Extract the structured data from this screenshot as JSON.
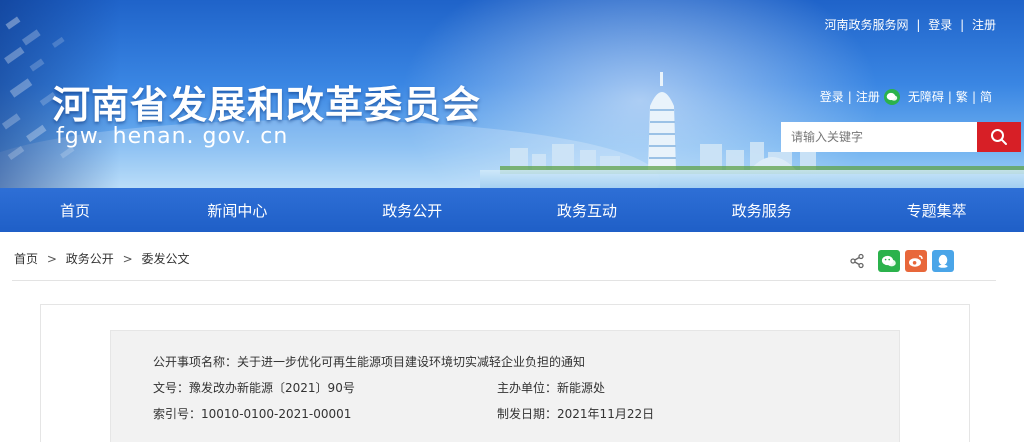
{
  "header": {
    "title": "河南省发展和改革委员会",
    "domain": "fgw. henan. gov. cn",
    "top_links": {
      "service_net": "河南政务服务网",
      "login": "登录",
      "register": "注册",
      "sep": "|"
    },
    "util_links": {
      "login": "登录",
      "register": "注册",
      "accessibility": "无障碍",
      "traditional": "繁",
      "simplified": "简",
      "sep": "|"
    },
    "search": {
      "placeholder": "请输入关键字",
      "button_color": "#d71f26"
    }
  },
  "nav": {
    "items": [
      {
        "label": "首页"
      },
      {
        "label": "新闻中心"
      },
      {
        "label": "政务公开"
      },
      {
        "label": "政务互动"
      },
      {
        "label": "政务服务"
      },
      {
        "label": "专题集萃"
      }
    ]
  },
  "breadcrumb": {
    "items": [
      "首页",
      "政务公开",
      "委发公文"
    ],
    "sep": ">"
  },
  "share": {
    "icons": [
      {
        "name": "share-icon"
      },
      {
        "name": "wechat-icon",
        "color": "#2bb24c"
      },
      {
        "name": "weibo-icon",
        "color": "#e8673a"
      },
      {
        "name": "qq-icon",
        "color": "#4aa5e8"
      }
    ]
  },
  "doc_info": {
    "title_label": "公开事项名称：",
    "title_value": "关于进一步优化可再生能源项目建设环境切实减轻企业负担的通知",
    "doc_no_label": "文号：",
    "doc_no_value": "豫发改办新能源〔2021〕90号",
    "dept_label": "主办单位：",
    "dept_value": "新能源处",
    "index_label": "索引号：",
    "index_value": "10010-0100-2021-00001",
    "date_label": "制发日期：",
    "date_value": "2021年11月22日"
  }
}
